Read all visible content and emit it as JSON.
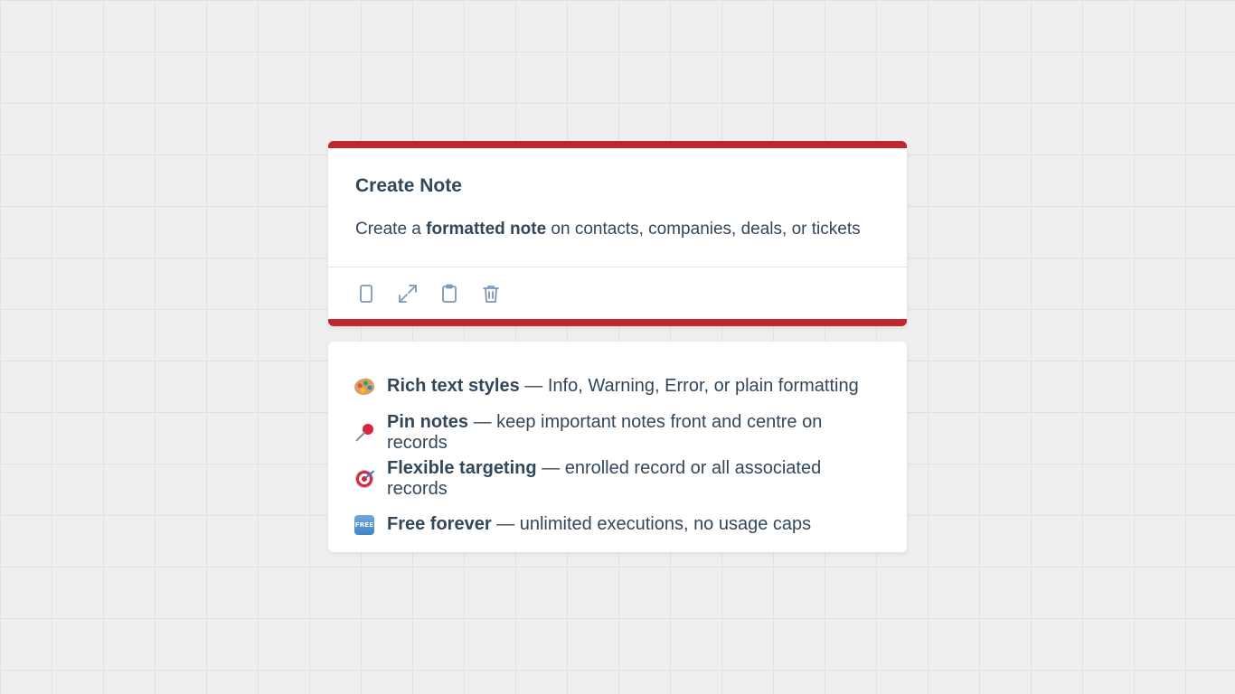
{
  "card": {
    "title": "Create Note",
    "description_prefix": "Create a ",
    "description_bold": "formatted note",
    "description_suffix": " on contacts, companies, deals, or tickets",
    "accent_color": "#c0262d",
    "toolbar": [
      {
        "icon": "tablet-icon"
      },
      {
        "icon": "expand-icon"
      },
      {
        "icon": "clipboard-icon"
      },
      {
        "icon": "trash-icon"
      }
    ]
  },
  "features": [
    {
      "icon": "artist-palette-emoji",
      "title": "Rich text styles",
      "rest": " — Info, Warning, Error, or plain formatting"
    },
    {
      "icon": "pushpin-emoji",
      "title": "Pin notes",
      "rest": " — keep important notes front and centre on records"
    },
    {
      "icon": "direct-hit-emoji",
      "title": "Flexible targeting",
      "rest": " — enrolled record or all associated records"
    },
    {
      "icon": "free-button-emoji",
      "badge_text": "FREE",
      "title": "Free forever",
      "rest": " — unlimited executions, no usage caps"
    }
  ]
}
